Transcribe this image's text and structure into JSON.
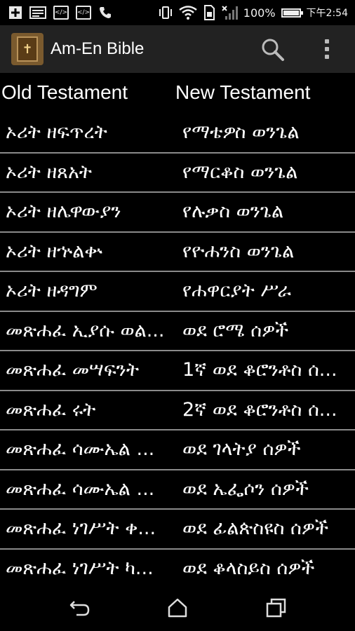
{
  "statusbar": {
    "battery_percent_label": "100%",
    "battery_level": 1.0,
    "time": "下午2:54",
    "left_icons": [
      "add-icon",
      "screenshot-icon",
      "code-icon",
      "code-icon",
      "call-icon"
    ],
    "right_icons": [
      "vibrate-icon",
      "wifi-icon",
      "sim-card-icon",
      "no-signal-icon",
      "battery-icon"
    ]
  },
  "appbar": {
    "title": "Am-En Bible",
    "icons": [
      "bible-app-icon",
      "search-icon",
      "overflow-menu-icon"
    ]
  },
  "columns": {
    "old": "Old Testament",
    "new": "New Testament"
  },
  "rows": [
    {
      "ot": "ኦሪት ዘፍጥረት",
      "nt": "የማቴዎስ ወንጌል"
    },
    {
      "ot": "ኦሪት ዘጸአት",
      "nt": "የማርቆስ ወንጌል"
    },
    {
      "ot": "ኦሪት ዘሌዋውያን",
      "nt": "የሉቃስ ወንጌል"
    },
    {
      "ot": "ኦሪት ዘኍልቍ",
      "nt": "የዮሐንስ ወንጌል"
    },
    {
      "ot": "ኦሪት ዘዳግም",
      "nt": "የሐዋርያት ሥራ"
    },
    {
      "ot": "መጽሐፈ ኢያሱ ወል...",
      "nt": "ወደ ሮሜ ሰዎች"
    },
    {
      "ot": "መጽሐፈ መሣፍንት",
      "nt": "1ኛ ወደ ቆሮንቶስ ሰ..."
    },
    {
      "ot": "መጽሐፈ ሩት",
      "nt": "2ኛ ወደ ቆሮንቶስ ሰ..."
    },
    {
      "ot": "መጽሐፈ ሳሙኤል ...",
      "nt": "ወደ ገላትያ ሰዎች"
    },
    {
      "ot": "መጽሐፈ ሳሙኤል ...",
      "nt": "ወደ ኤፌሶን ሰዎች"
    },
    {
      "ot": "መጽሐፈ ነገሥት ቀ...",
      "nt": "ወደ ፊልጵስዩስ ሰዎች"
    },
    {
      "ot": "መጽሐፈ ነገሥት ካ...",
      "nt": "ወደ ቆላስይስ ሰዎች"
    }
  ],
  "navbar": {
    "icons": [
      "back-icon",
      "home-icon",
      "recents-icon"
    ]
  },
  "colors": {
    "background": "#000000",
    "appbar": "#222222",
    "divider": "#8a8a8a",
    "text": "#ffffff"
  }
}
